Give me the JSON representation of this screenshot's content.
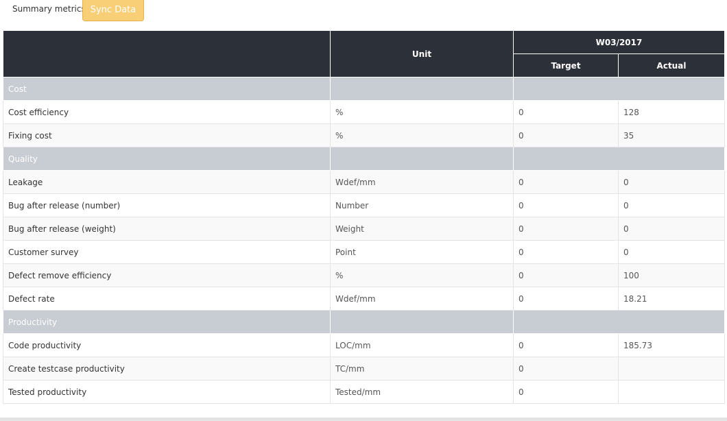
{
  "header": {
    "title": "Summary metrics",
    "sync_button": "Sync Data"
  },
  "table": {
    "columns": {
      "unit": "Unit",
      "period": "W03/2017",
      "target": "Target",
      "actual": "Actual"
    },
    "groups": [
      {
        "name": "Cost",
        "rows": [
          {
            "metric": "Cost efficiency",
            "unit": "%",
            "target": "0",
            "actual": "128"
          },
          {
            "metric": "Fixing cost",
            "unit": "%",
            "target": "0",
            "actual": "35"
          }
        ]
      },
      {
        "name": "Quality",
        "rows": [
          {
            "metric": "Leakage",
            "unit": "Wdef/mm",
            "target": "0",
            "actual": "0"
          },
          {
            "metric": "Bug after release (number)",
            "unit": "Number",
            "target": "0",
            "actual": "0"
          },
          {
            "metric": "Bug after release (weight)",
            "unit": "Weight",
            "target": "0",
            "actual": "0"
          },
          {
            "metric": "Customer survey",
            "unit": "Point",
            "target": "0",
            "actual": "0"
          },
          {
            "metric": "Defect remove efficiency",
            "unit": "%",
            "target": "0",
            "actual": "100"
          },
          {
            "metric": "Defect rate",
            "unit": "Wdef/mm",
            "target": "0",
            "actual": "18.21"
          }
        ]
      },
      {
        "name": "Productivity",
        "rows": [
          {
            "metric": "Code productivity",
            "unit": "LOC/mm",
            "target": "0",
            "actual": "185.73"
          },
          {
            "metric": "Create testcase productivity",
            "unit": "TC/mm",
            "target": "0",
            "actual": ""
          },
          {
            "metric": "Tested productivity",
            "unit": "Tested/mm",
            "target": "0",
            "actual": ""
          }
        ]
      }
    ]
  },
  "colors": {
    "header_bg": "#2b3039",
    "group_bg": "#c8ccd3",
    "button_bg": "#f8cf77"
  }
}
